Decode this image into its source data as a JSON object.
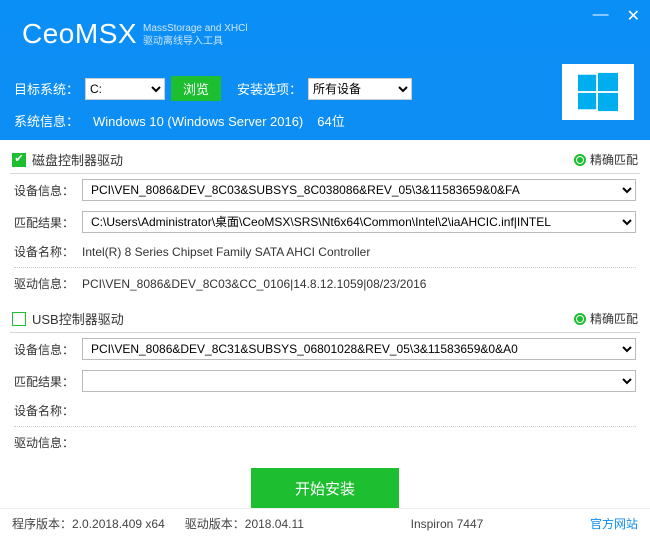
{
  "brand": {
    "name": "CeoMSX",
    "tag1": "MassStorage and XHCl",
    "tag2": "驱动离线导入工具"
  },
  "titlebar": {
    "min": "—",
    "close": "✕"
  },
  "top": {
    "target_label": "目标系统：",
    "drive": "C:",
    "browse": "浏览",
    "option_label": "安装选项：",
    "device_opt": "所有设备"
  },
  "sys": {
    "label": "系统信息：",
    "os": "Windows 10 (Windows Server 2016)",
    "arch": "64位"
  },
  "sec1": {
    "title": "磁盘控制器驱动",
    "match": "精确匹配",
    "dev_label": "设备信息：",
    "dev_val": "PCI\\VEN_8086&DEV_8C03&SUBSYS_8C038086&REV_05\\3&11583659&0&FA",
    "res_label": "匹配结果：",
    "res_val": "C:\\Users\\Administrator\\桌面\\CeoMSX\\SRS\\Nt6x64\\Common\\Intel\\2\\iaAHCIC.inf|INTEL",
    "name_label": "设备名称：",
    "name_val": "Intel(R) 8 Series Chipset Family SATA AHCI Controller",
    "drv_label": "驱动信息：",
    "drv_val": "PCI\\VEN_8086&DEV_8C03&CC_0106|14.8.12.1059|08/23/2016"
  },
  "sec2": {
    "title": "USB控制器驱动",
    "match": "精确匹配",
    "dev_label": "设备信息：",
    "dev_val": "PCI\\VEN_8086&DEV_8C31&SUBSYS_06801028&REV_05\\3&11583659&0&A0",
    "res_label": "匹配结果：",
    "res_val": "",
    "name_label": "设备名称：",
    "name_val": "",
    "drv_label": "驱动信息：",
    "drv_val": ""
  },
  "action": {
    "start": "开始安装"
  },
  "footer": {
    "ver_label": "程序版本：",
    "ver": "2.0.2018.409 x64",
    "drv_ver_label": "驱动版本：",
    "drv_ver": "2018.04.11",
    "model": "Inspiron 7447",
    "site": "官方网站"
  }
}
